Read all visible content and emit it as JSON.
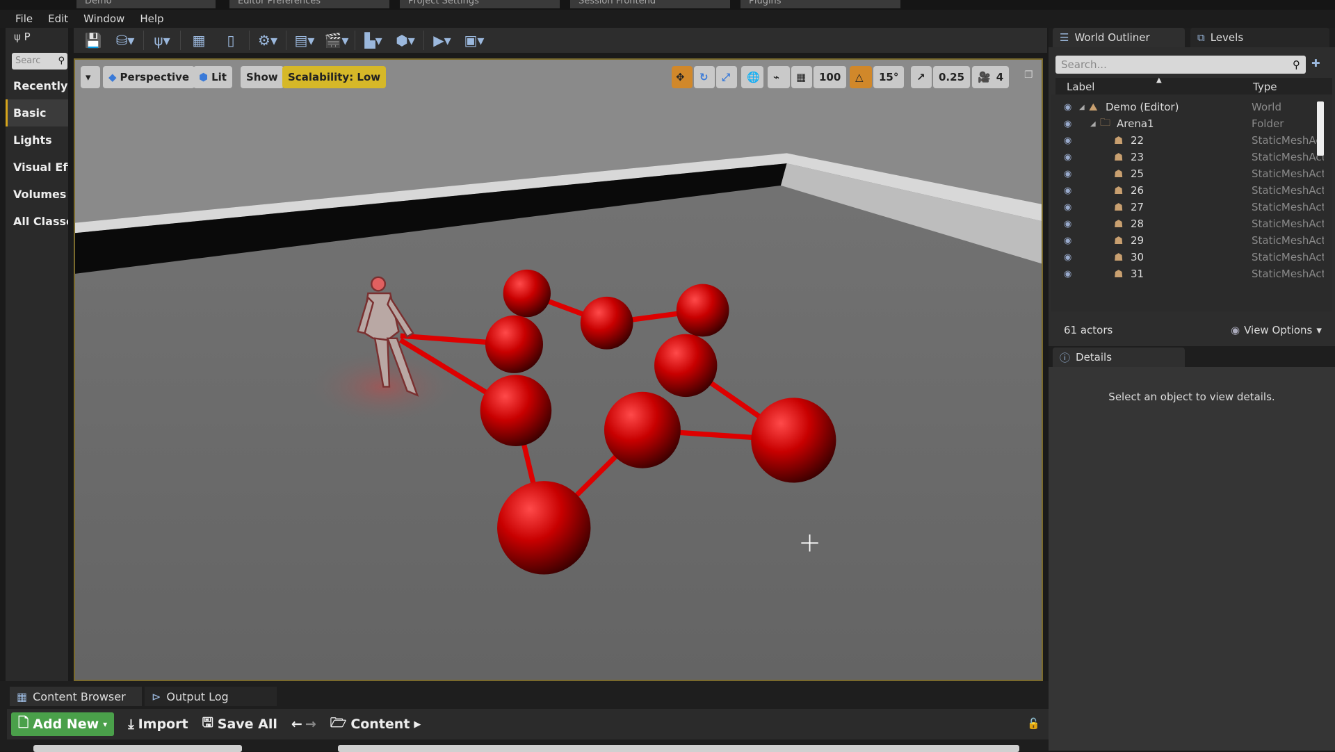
{
  "window_tabs": [
    "Demo",
    "Editor Preferences",
    "Project Settings",
    "Session Frontend",
    "Plugins"
  ],
  "menu": [
    "File",
    "Edit",
    "Window",
    "Help"
  ],
  "modes": {
    "tab_label": "P",
    "search_placeholder": "Searc",
    "items": [
      "Recently",
      "Basic",
      "Lights",
      "Visual Eff",
      "Volumes",
      "All Classe"
    ],
    "active": "Basic"
  },
  "viewport": {
    "view_mode": "Perspective",
    "lighting": "Lit",
    "show": "Show",
    "scalability": "Scalability: Low",
    "grid_snap": "100",
    "rotation_snap": "15°",
    "scale_snap": "0.25",
    "camera_speed": "4"
  },
  "outliner": {
    "tab": "World Outliner",
    "levels_tab": "Levels",
    "search_placeholder": "Search...",
    "col_label": "Label",
    "col_type": "Type",
    "rows": [
      {
        "label": "Demo (Editor)",
        "type": "World"
      },
      {
        "label": "Arena1",
        "type": "Folder"
      },
      {
        "label": "22",
        "type": "StaticMeshActor"
      },
      {
        "label": "23",
        "type": "StaticMeshActor"
      },
      {
        "label": "25",
        "type": "StaticMeshActor"
      },
      {
        "label": "26",
        "type": "StaticMeshActor"
      },
      {
        "label": "27",
        "type": "StaticMeshActor"
      },
      {
        "label": "28",
        "type": "StaticMeshActor"
      },
      {
        "label": "29",
        "type": "StaticMeshActor"
      },
      {
        "label": "30",
        "type": "StaticMeshActor"
      },
      {
        "label": "31",
        "type": "StaticMeshActor"
      }
    ],
    "count": "61 actors",
    "view_options": "View Options"
  },
  "details": {
    "tab": "Details",
    "empty_message": "Select an object to view details."
  },
  "bottom": {
    "tabs": [
      "Content Browser",
      "Output Log"
    ],
    "add_new": "Add New",
    "import": "Import",
    "save_all": "Save All",
    "path": "Content"
  },
  "colors": {
    "accent": "#d6b828",
    "sphere": "#c80000",
    "add_new": "#4aa04a"
  }
}
